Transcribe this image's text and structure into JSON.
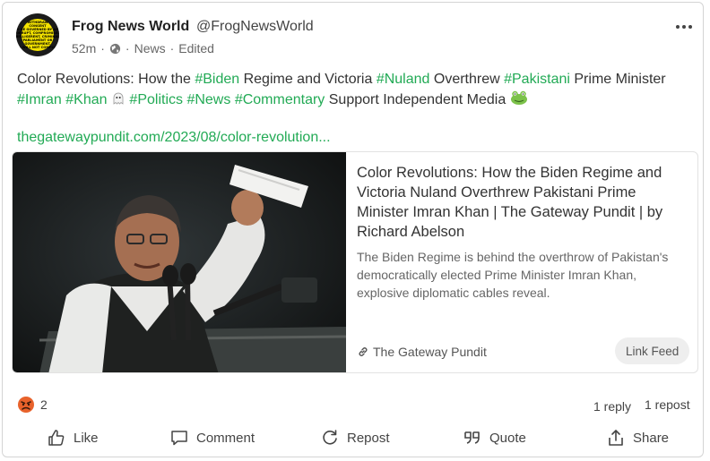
{
  "post": {
    "author_name": "Frog News World",
    "author_handle": "@FrogNewsWorld",
    "time": "52m",
    "separator": "·",
    "category": "News",
    "edited": "Edited",
    "avatar_lines": [
      "WITHDRAW",
      "CONSENT",
      "TO BE GOVERNED BY ANY",
      "CORRUPT, COMPROMISED,",
      "BELLIGERENT, CRIMINAL",
      "PARLIAMENT OR",
      "GOVERNMENT.",
      "I WILL NOT COMPLY"
    ],
    "text_segments": [
      {
        "text": "Color Revolutions: How the ",
        "tag": false
      },
      {
        "text": "#Biden",
        "tag": true
      },
      {
        "text": " Regime and Victoria ",
        "tag": false
      },
      {
        "text": "#Nuland",
        "tag": true
      },
      {
        "text": " Overthrew ",
        "tag": false
      },
      {
        "text": "#Pakistani",
        "tag": true
      },
      {
        "text": " Prime Minister ",
        "tag": false
      },
      {
        "text": "#Imran",
        "tag": true
      },
      {
        "text": " ",
        "tag": false
      },
      {
        "text": "#Khan",
        "tag": true
      },
      {
        "text": " ",
        "tag": false
      },
      {
        "text": "#Politics",
        "tag": true
      },
      {
        "text": " ",
        "tag": false
      },
      {
        "text": "#News",
        "tag": true
      },
      {
        "text": " ",
        "tag": false
      },
      {
        "text": "#Commentary",
        "tag": true
      },
      {
        "text": " Support Independent Media ",
        "tag": false
      }
    ],
    "link": "thegatewaypundit.com/2023/08/color-revolution...",
    "hashtag_color": "#22aa55"
  },
  "preview": {
    "title": "Color Revolutions: How the Biden Regime and Victoria Nuland Overthrew Pakistani Prime Minister Imran Khan | The Gateway Pundit | by Richard Abelson",
    "description": "The Biden Regime is behind the overthrow of Pakistan's democratically elected Prime Minister Imran Khan, explosive diplomatic cables reveal.",
    "source": "The Gateway Pundit",
    "feed_button": "Link Feed",
    "image_alt": "man-speaking-at-microphones-photo"
  },
  "stats": {
    "reaction_count": "2",
    "replies": "1 reply",
    "reposts": "1 repost"
  },
  "actions": {
    "like": "Like",
    "comment": "Comment",
    "repost": "Repost",
    "quote": "Quote",
    "share": "Share"
  }
}
